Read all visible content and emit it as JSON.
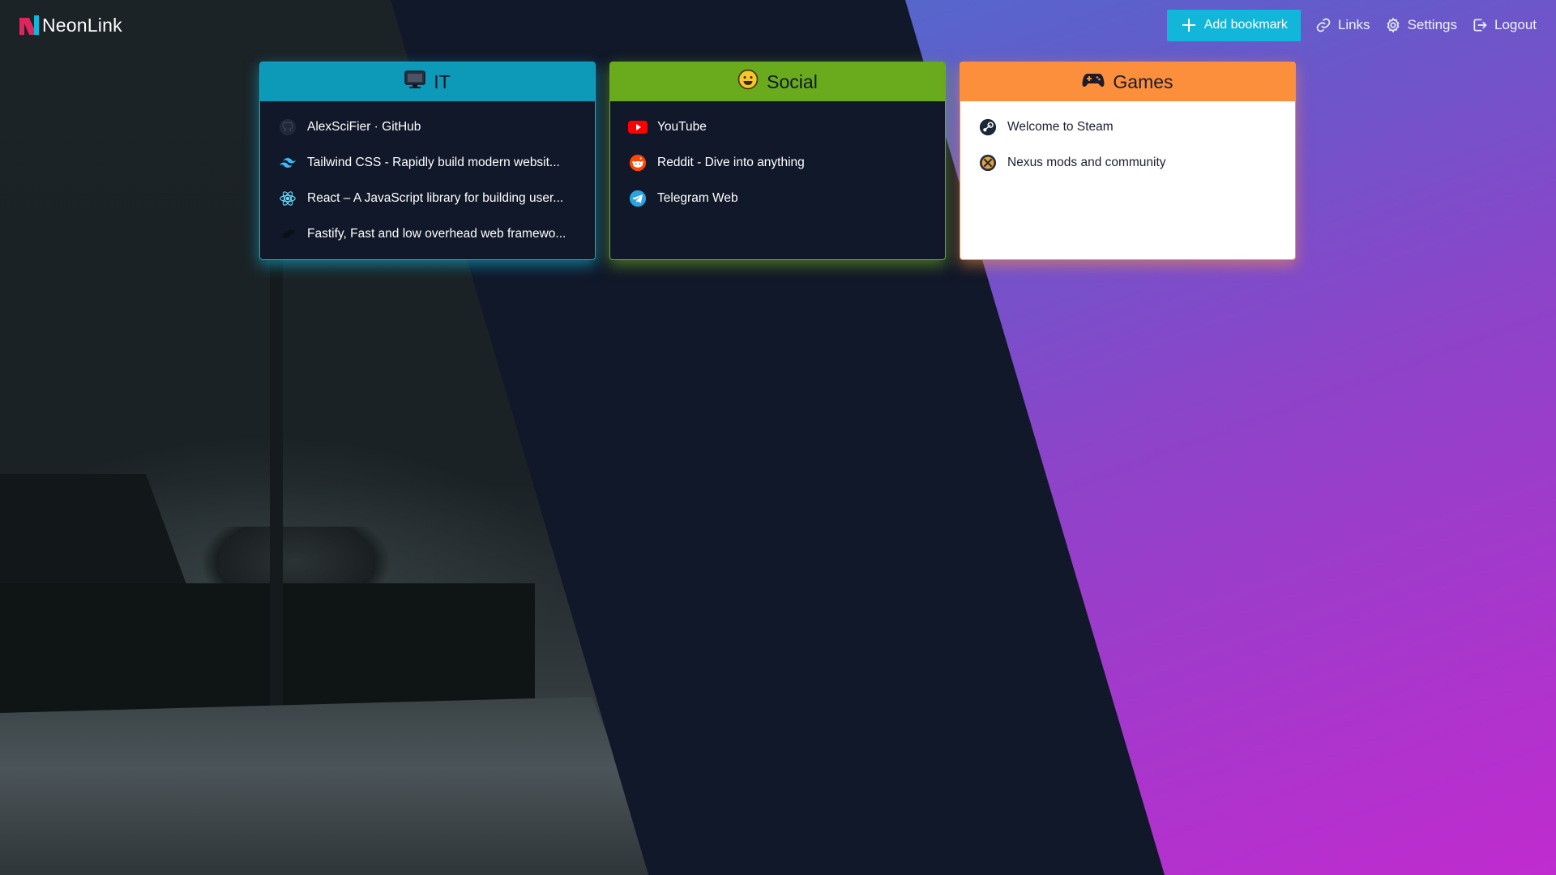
{
  "brand": {
    "name": "NeonLink",
    "logo_icon": "neonlink-logo-icon"
  },
  "nav": {
    "add_bookmark": "Add bookmark",
    "links": "Links",
    "settings": "Settings",
    "logout": "Logout"
  },
  "colors": {
    "accent_cyan": "#12b6d8",
    "it_header": "#0d9ab9",
    "social_header": "#6aaa1d",
    "games_header": "#fb8f3c",
    "navy": "#111829"
  },
  "categories": [
    {
      "title": "IT",
      "icon": "monitor-icon",
      "items": [
        {
          "label": "AlexSciFier · GitHub",
          "icon": "github-icon"
        },
        {
          "label": "Tailwind CSS - Rapidly build modern websit...",
          "icon": "tailwind-icon"
        },
        {
          "label": "React – A JavaScript library for building user...",
          "icon": "react-icon"
        },
        {
          "label": "Fastify, Fast and low overhead web framewo...",
          "icon": "fastify-icon"
        }
      ]
    },
    {
      "title": "Social",
      "icon": "smile-emoji-icon",
      "items": [
        {
          "label": "YouTube",
          "icon": "youtube-icon"
        },
        {
          "label": "Reddit - Dive into anything",
          "icon": "reddit-icon"
        },
        {
          "label": "Telegram Web",
          "icon": "telegram-icon"
        }
      ]
    },
    {
      "title": "Games",
      "icon": "gamepad-icon",
      "items": [
        {
          "label": "Welcome to Steam",
          "icon": "steam-icon"
        },
        {
          "label": "Nexus mods and community",
          "icon": "nexus-icon"
        }
      ]
    }
  ]
}
